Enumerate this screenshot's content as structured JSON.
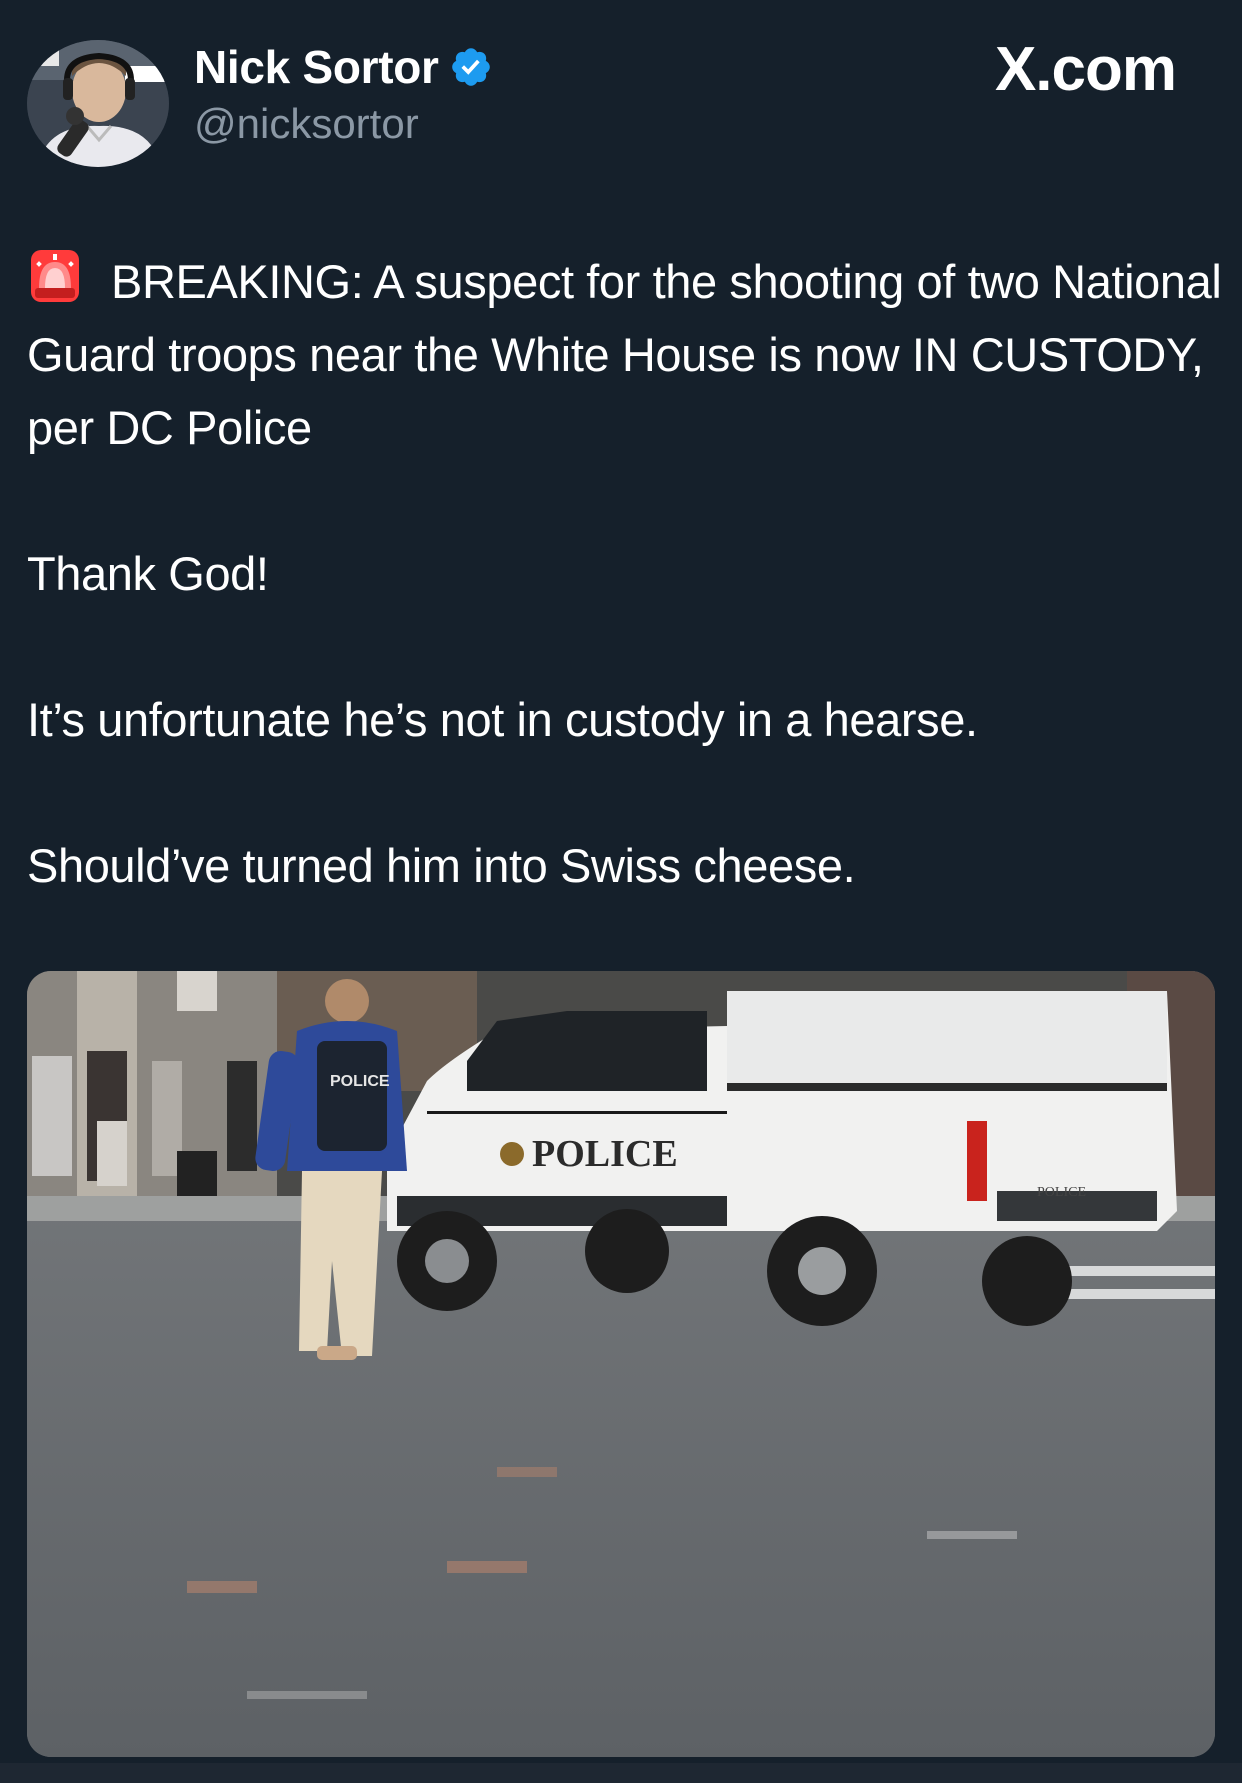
{
  "author": {
    "display_name": "Nick Sortor",
    "handle": "@nicksortor",
    "verified": true,
    "verified_color": "#1d9bf0"
  },
  "brand": {
    "label": "X.com"
  },
  "tweet": {
    "emoji_icon": "rotating-light-icon",
    "line1": "BREAKING: A suspect for the shooting of two National Guard troops near the White House is now IN CUSTODY, per DC Police",
    "line2": "Thank God!",
    "line3": "It’s unfortunate he’s not in custody in a hearse.",
    "line4": "Should’ve turned him into Swiss cheese."
  },
  "media": {
    "vest_text": "POLICE",
    "truck_text": "POLICE",
    "tailgate_text": "POLICE"
  },
  "colors": {
    "background": "#15202b",
    "text": "#ffffff",
    "secondary": "#8b98a5"
  }
}
